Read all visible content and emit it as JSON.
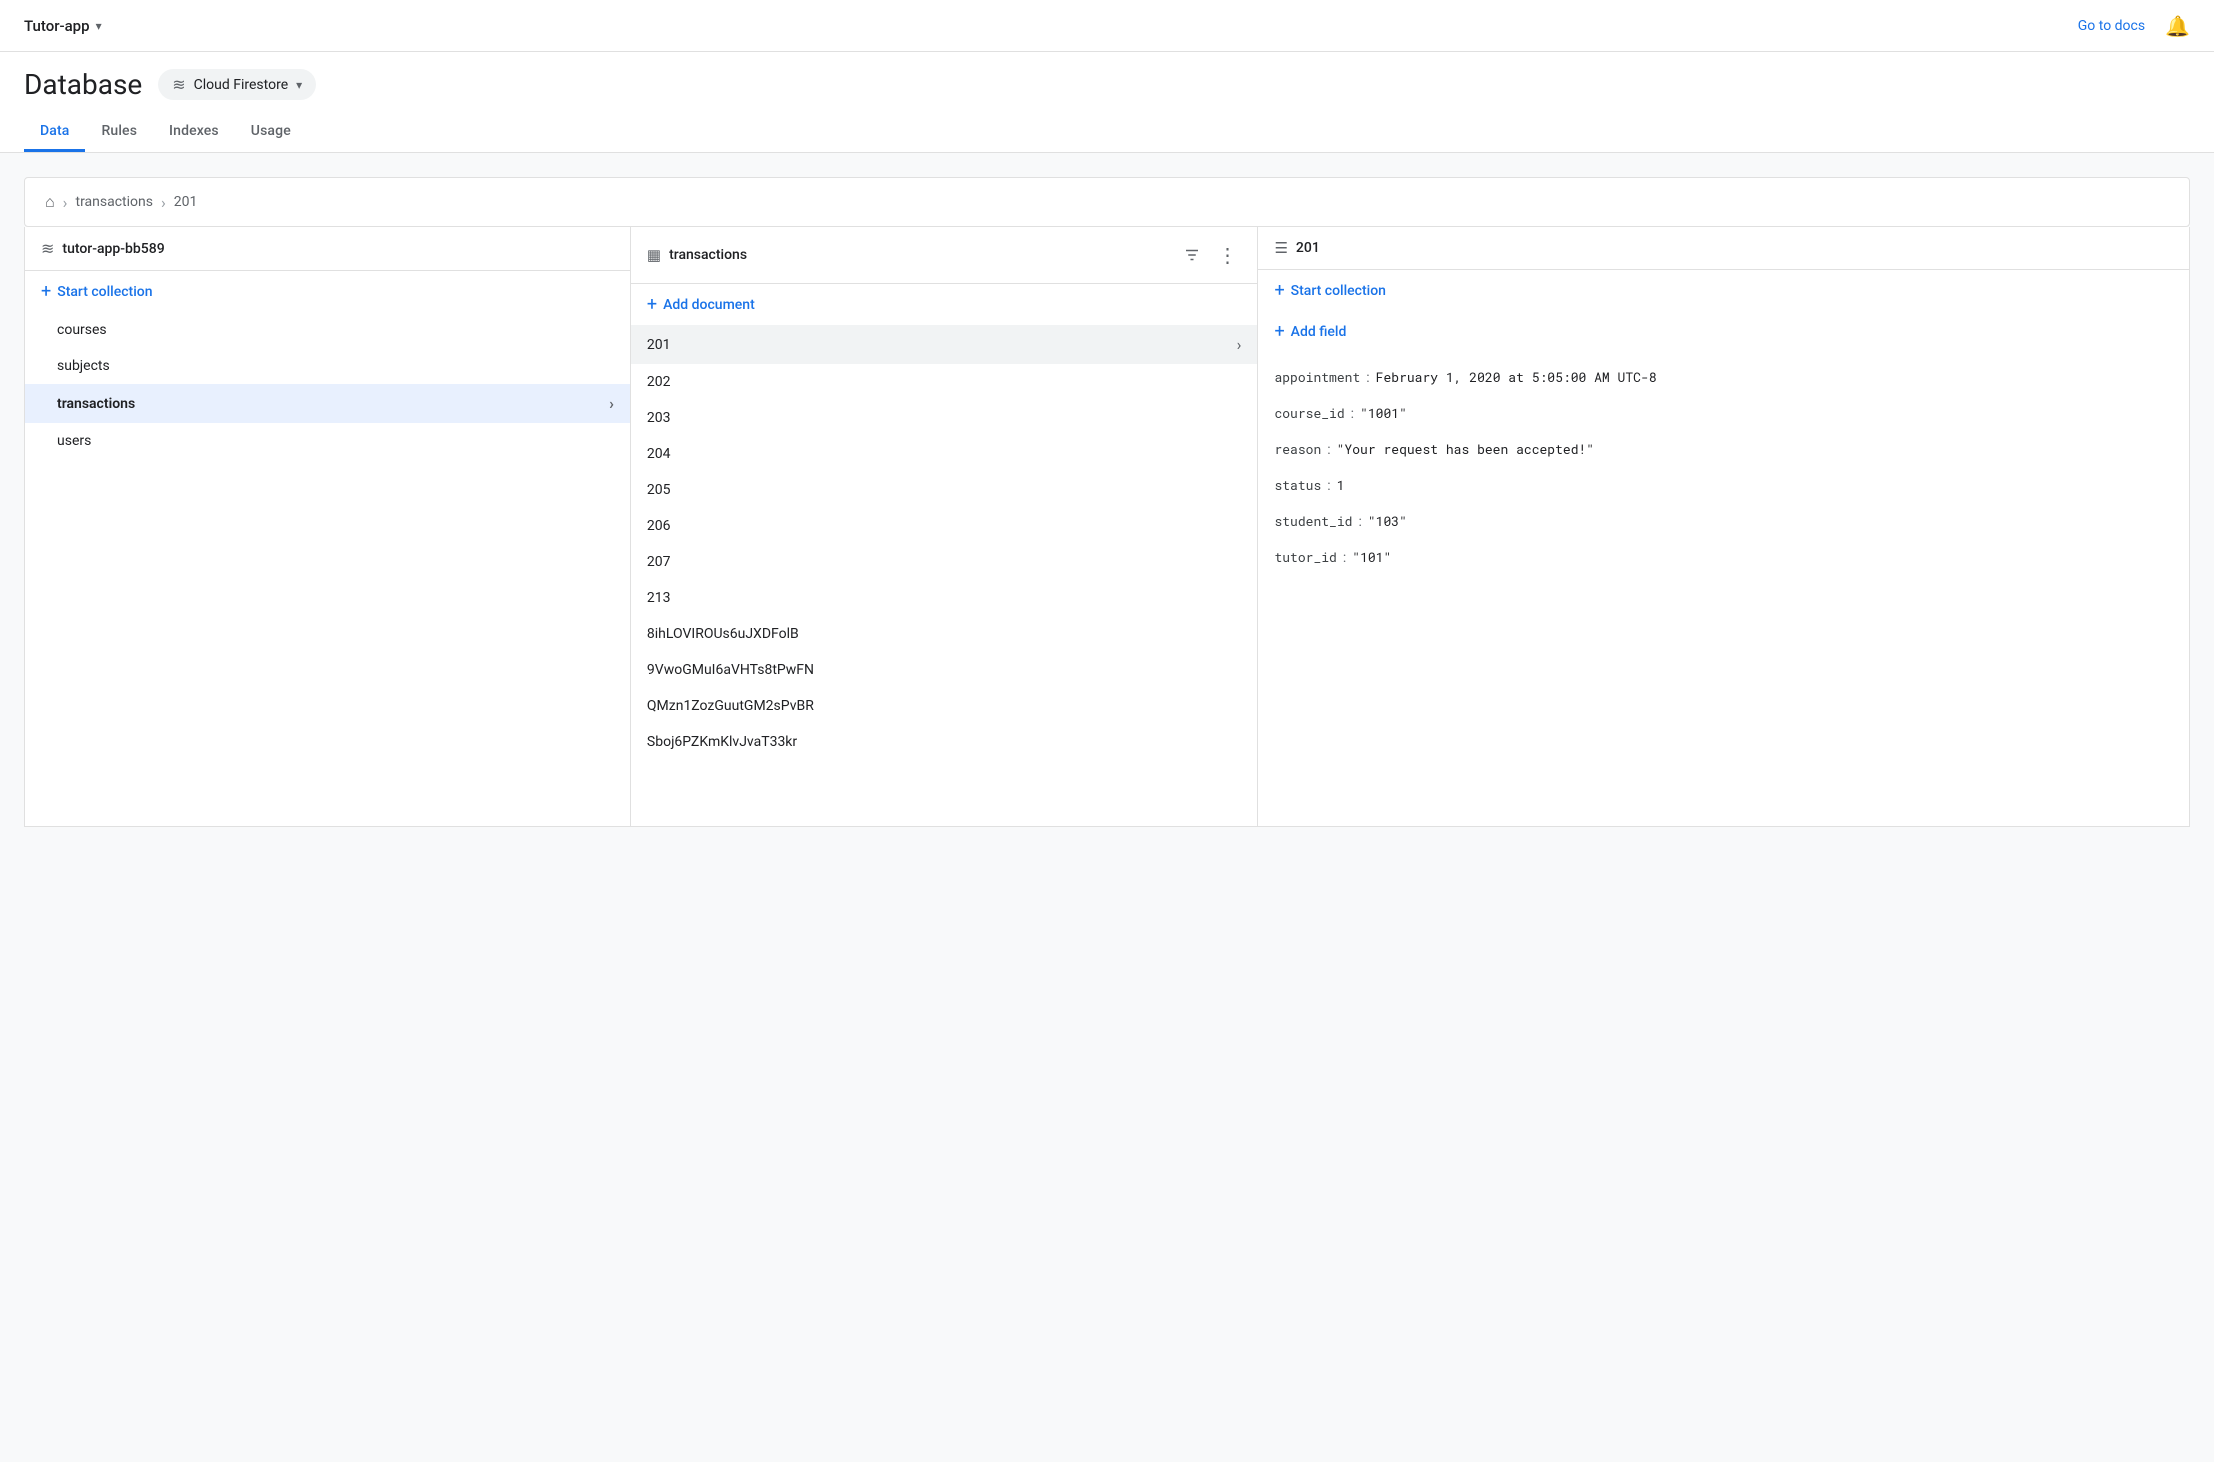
{
  "topbar": {
    "app_name": "Tutor-app",
    "dropdown_arrow": "▾",
    "go_to_docs": "Go to docs",
    "bell_label": "notifications"
  },
  "page_header": {
    "title": "Database",
    "db_selector": {
      "label": "Cloud Firestore",
      "arrow": "▾"
    },
    "tabs": [
      {
        "id": "data",
        "label": "Data",
        "active": true
      },
      {
        "id": "rules",
        "label": "Rules",
        "active": false
      },
      {
        "id": "indexes",
        "label": "Indexes",
        "active": false
      },
      {
        "id": "usage",
        "label": "Usage",
        "active": false
      }
    ]
  },
  "breadcrumb": {
    "home": "⌂",
    "sep1": ">",
    "link1": "transactions",
    "sep2": ">",
    "link2": "201"
  },
  "panel_left": {
    "header": {
      "icon": "≋",
      "title": "tutor-app-bb589"
    },
    "start_collection_label": "Start collection",
    "collections": [
      {
        "id": "courses",
        "label": "courses",
        "active": false
      },
      {
        "id": "subjects",
        "label": "subjects",
        "active": false
      },
      {
        "id": "transactions",
        "label": "transactions",
        "active": true,
        "has_chevron": true
      },
      {
        "id": "users",
        "label": "users",
        "active": false
      }
    ]
  },
  "panel_middle": {
    "header": {
      "icon": "▦",
      "title": "transactions",
      "filter_icon": "filter",
      "more_icon": "⋮"
    },
    "add_document_label": "Add document",
    "documents": [
      {
        "id": "201",
        "label": "201",
        "active": true
      },
      {
        "id": "202",
        "label": "202",
        "active": false
      },
      {
        "id": "203",
        "label": "203",
        "active": false
      },
      {
        "id": "204",
        "label": "204",
        "active": false
      },
      {
        "id": "205",
        "label": "205",
        "active": false
      },
      {
        "id": "206",
        "label": "206",
        "active": false
      },
      {
        "id": "207",
        "label": "207",
        "active": false
      },
      {
        "id": "213",
        "label": "213",
        "active": false
      },
      {
        "id": "8ihLOVIROUs6uJXDFolB",
        "label": "8ihLOVIROUs6uJXDFolB",
        "active": false
      },
      {
        "id": "9VwoGMuI6aVHTs8tPwFN",
        "label": "9VwoGMuI6aVHTs8tPwFN",
        "active": false
      },
      {
        "id": "QMzn1ZozGuutGM2sPvBR",
        "label": "QMzn1ZozGuutGM2sPvBR",
        "active": false
      },
      {
        "id": "Sboj6PZKmKlvJvaT33kr",
        "label": "Sboj6PZKmKlvJvaT33kr",
        "active": false
      }
    ]
  },
  "panel_right": {
    "header": {
      "icon": "☰",
      "title": "201"
    },
    "start_collection_label": "Start collection",
    "add_field_label": "Add field",
    "fields": [
      {
        "key": "appointment",
        "colon": ":",
        "value": "February 1, 2020 at 5:05:00 AM UTC-8",
        "type": "timestamp"
      },
      {
        "key": "course_id",
        "colon": ":",
        "value": "\"1001\"",
        "type": "string"
      },
      {
        "key": "reason",
        "colon": ":",
        "value": "\"Your request has been accepted!\"",
        "type": "string"
      },
      {
        "key": "status",
        "colon": ":",
        "value": "1",
        "type": "number"
      },
      {
        "key": "student_id",
        "colon": ":",
        "value": "\"103\"",
        "type": "string"
      },
      {
        "key": "tutor_id",
        "colon": ":",
        "value": "\"101\"",
        "type": "string"
      }
    ]
  },
  "colors": {
    "accent": "#1a73e8",
    "active_bg": "#e8f0fe",
    "border": "#e0e0e0",
    "text_primary": "#202124",
    "text_secondary": "#5f6368"
  }
}
